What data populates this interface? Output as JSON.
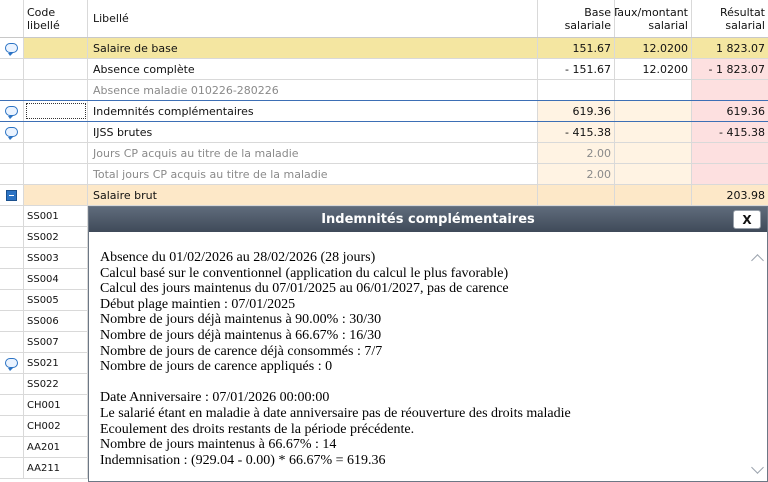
{
  "columns": {
    "code": [
      "Code",
      "libellé"
    ],
    "libelle": "Libellé",
    "base": [
      "Base",
      "salariale"
    ],
    "taux": [
      "Taux/montant",
      "salarial"
    ],
    "resultat": [
      "Résultat",
      "salarial"
    ]
  },
  "rows": [
    {
      "libelle": "Salaire de base",
      "base": "151.67",
      "taux": "12.0200",
      "resultat": "1 823.07"
    },
    {
      "libelle": "Absence complète",
      "base": "- 151.67",
      "taux": "12.0200",
      "resultat": "- 1 823.07"
    },
    {
      "libelle": "Absence maladie 010226-280226",
      "base": "",
      "taux": "",
      "resultat": ""
    },
    {
      "libelle": "Indemnités complémentaires",
      "base": "619.36",
      "taux": "",
      "resultat": "619.36"
    },
    {
      "libelle": "IJSS brutes",
      "base": "- 415.38",
      "taux": "",
      "resultat": "- 415.38"
    },
    {
      "libelle": "Jours CP acquis au titre de la maladie",
      "base": "2.00",
      "taux": "",
      "resultat": ""
    },
    {
      "libelle": "Total jours CP acquis au titre de la maladie",
      "base": "2.00",
      "taux": "",
      "resultat": ""
    },
    {
      "libelle": "Salaire brut",
      "base": "",
      "taux": "",
      "resultat": "203.98"
    }
  ],
  "codes": [
    "SS001",
    "SS002",
    "SS003",
    "SS004",
    "SS005",
    "SS006",
    "SS007",
    "SS021",
    "SS022",
    "CH001",
    "CH002",
    "AA201",
    "AA211"
  ],
  "dialog": {
    "title": "Indemnités complémentaires",
    "close_label": "X",
    "lines": [
      "Absence du 01/02/2026 au 28/02/2026 (28 jours)",
      "Calcul basé sur le conventionnel (application du calcul le plus favorable)",
      "Calcul des jours maintenus du 07/01/2025 au 06/01/2027, pas de carence",
      "Début plage maintien : 07/01/2025",
      "Nombre de jours déjà maintenus à 90.00% : 30/30",
      "Nombre de jours déjà maintenus à 66.67% : 16/30",
      "Nombre de jours de carence déjà consommés : 7/7",
      "Nombre de jours de carence appliqués : 0",
      "",
      "Date Anniversaire : 07/01/2026 00:00:00",
      "Le salarié étant en maladie à date anniversaire pas de réouverture des droits maladie",
      "Ecoulement des droits restants de la période précédente.",
      "Nombre de jours maintenus à 66.67% : 14",
      "Indemnisation : (929.04 - 0.00) * 66.67% = 619.36"
    ]
  },
  "colors": {
    "highlight": "#f4e6a1",
    "pink": "#fde0e0",
    "peach": "#fff3e3",
    "brut": "#fde8c8",
    "accent": "#2b73c4",
    "dialog_title": "#4a5564"
  }
}
